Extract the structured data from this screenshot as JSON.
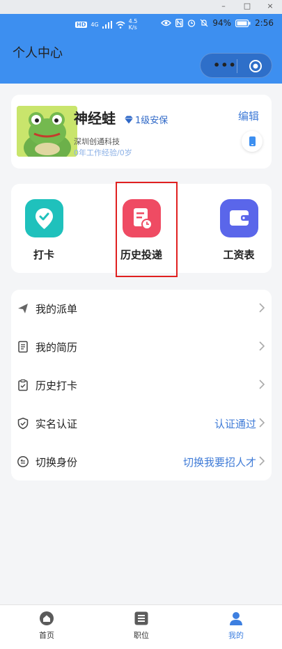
{
  "window_controls": {
    "minimize": "–",
    "maximize": "□",
    "close": "×"
  },
  "status_bar": {
    "hd": "HD",
    "net": "4G",
    "speed_top": "4.5",
    "speed_unit": "K/s",
    "battery": "94%",
    "time": "2:56"
  },
  "header": {
    "title": "个人中心"
  },
  "profile": {
    "name": "神经蛙",
    "badge": "1级安保",
    "company": "深圳创通科技",
    "experience": "0年工作经验/0岁",
    "edit_label": "编辑"
  },
  "shortcuts": [
    {
      "label": "打卡",
      "icon": "location-check-icon",
      "color": "#1fc1bc"
    },
    {
      "label": "历史投递",
      "icon": "document-clock-icon",
      "color": "#ef4b63"
    },
    {
      "label": "工资表",
      "icon": "wallet-icon",
      "color": "#5a66ea"
    }
  ],
  "menu": [
    {
      "label": "我的派单",
      "value": "",
      "icon": "send-icon"
    },
    {
      "label": "我的简历",
      "value": "",
      "icon": "resume-icon"
    },
    {
      "label": "历史打卡",
      "value": "",
      "icon": "clipboard-check-icon"
    },
    {
      "label": "实名认证",
      "value": "认证通过",
      "icon": "shield-check-icon"
    },
    {
      "label": "切换身份",
      "value": "切换我要招人才",
      "icon": "switch-icon"
    }
  ],
  "tabbar": [
    {
      "label": "首页",
      "icon": "home-icon"
    },
    {
      "label": "职位",
      "icon": "list-icon"
    },
    {
      "label": "我的",
      "icon": "person-icon"
    }
  ],
  "colors": {
    "primary": "#3d8ff0",
    "active_tab": "#3d7fe0",
    "link": "#3f7bd7"
  }
}
